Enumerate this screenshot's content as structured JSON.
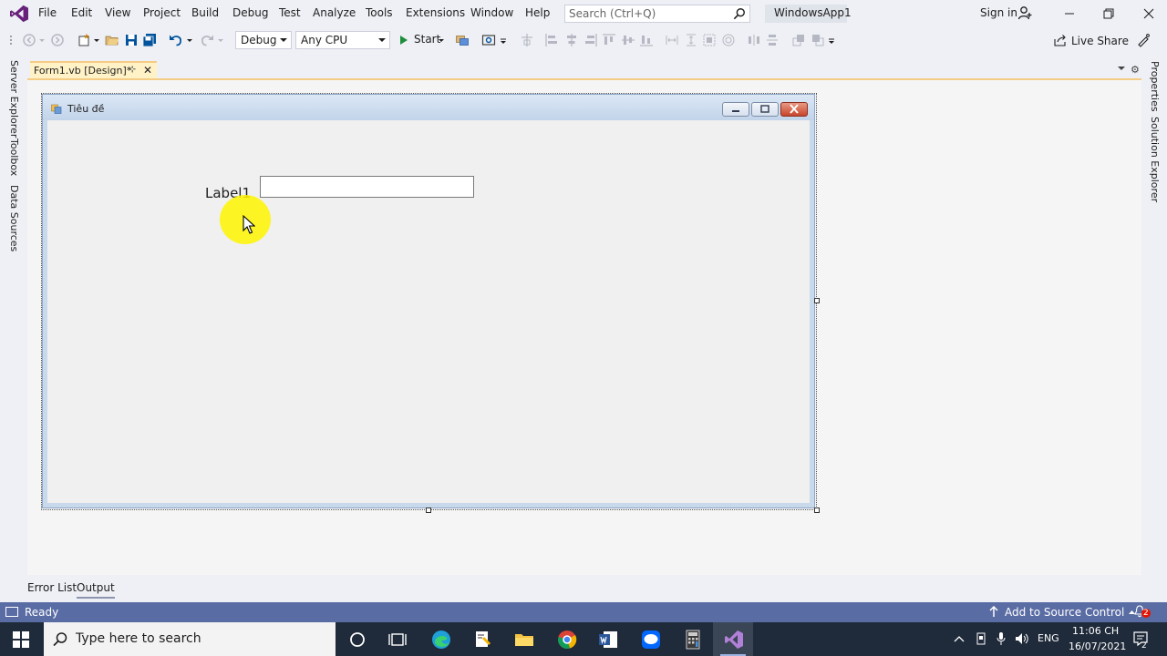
{
  "menubar": {
    "items": [
      "File",
      "Edit",
      "View",
      "Project",
      "Build",
      "Debug",
      "Test",
      "Analyze",
      "Tools",
      "Extensions",
      "Window",
      "Help"
    ],
    "search_placeholder": "Search (Ctrl+Q)",
    "solution_name": "WindowsApp1",
    "sign_in": "Sign in"
  },
  "toolbar": {
    "config": "Debug",
    "platform": "Any CPU",
    "start": "Start",
    "live_share": "Live Share"
  },
  "left_rail": [
    "Server Explorer",
    "Toolbox",
    "Data Sources"
  ],
  "right_rail": [
    "Properties",
    "Solution Explorer"
  ],
  "document_tab": {
    "label": "Form1.vb [Design]*",
    "pin": "⊹",
    "close": "✕"
  },
  "form": {
    "title": "Tiêu đề",
    "label1": "Label1",
    "textbox1": ""
  },
  "bottom_tabs": [
    "Error List",
    "Output"
  ],
  "statusbar": {
    "text": "Ready",
    "source_control": "Add to Source Control",
    "notification_count": "2"
  },
  "taskbar": {
    "search_placeholder": "Type here to search",
    "lang": "ENG",
    "time": "11:06 CH",
    "date": "16/07/2021"
  },
  "colors": {
    "accent": "#5a6ca4",
    "tab_active": "#fff2c7",
    "tab_border": "#f5cc84",
    "vs_purple": "#68217a"
  }
}
